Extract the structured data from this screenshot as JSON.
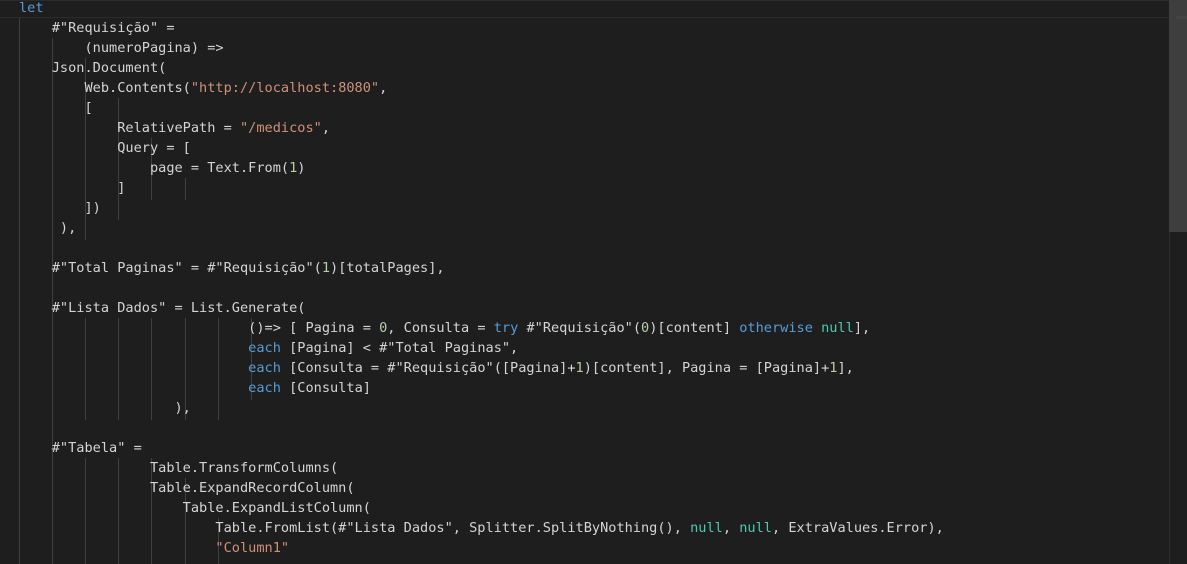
{
  "editor": {
    "language": "Power Query M",
    "colors": {
      "background": "#1e1e1e",
      "text": "#d4d4d4",
      "keyword": "#569cd6",
      "string": "#ce9178",
      "number": "#b5cea8",
      "null_literal": "#4ec9b0",
      "indent_guide": "#404040"
    },
    "lines": [
      [
        {
          "t": "let",
          "c": "kw"
        }
      ],
      [
        {
          "t": "    #\"Requisição\" ="
        }
      ],
      [
        {
          "t": "        (numeroPagina) =>"
        }
      ],
      [
        {
          "t": "    Json.Document("
        }
      ],
      [
        {
          "t": "        Web.Contents("
        },
        {
          "t": "\"http://localhost:8080\"",
          "c": "str"
        },
        {
          "t": ","
        }
      ],
      [
        {
          "t": "        ["
        }
      ],
      [
        {
          "t": "            RelativePath = "
        },
        {
          "t": "\"/medicos\"",
          "c": "str"
        },
        {
          "t": ","
        }
      ],
      [
        {
          "t": "            Query = ["
        }
      ],
      [
        {
          "t": "                page = Text.From("
        },
        {
          "t": "1",
          "c": "num"
        },
        {
          "t": ")"
        }
      ],
      [
        {
          "t": "            ]"
        }
      ],
      [
        {
          "t": "        ])"
        }
      ],
      [
        {
          "t": "     ),"
        }
      ],
      [],
      [
        {
          "t": "    #\"Total Paginas\" = #\"Requisição\"("
        },
        {
          "t": "1",
          "c": "num"
        },
        {
          "t": ")[totalPages],"
        }
      ],
      [],
      [
        {
          "t": "    #\"Lista Dados\" = List.Generate("
        }
      ],
      [
        {
          "t": "                            ()=> [ Pagina = "
        },
        {
          "t": "0",
          "c": "num"
        },
        {
          "t": ", Consulta = "
        },
        {
          "t": "try",
          "c": "kw"
        },
        {
          "t": " #\"Requisição\"("
        },
        {
          "t": "0",
          "c": "num"
        },
        {
          "t": ")[content] "
        },
        {
          "t": "otherwise",
          "c": "kw"
        },
        {
          "t": " "
        },
        {
          "t": "null",
          "c": "null"
        },
        {
          "t": "],"
        }
      ],
      [
        {
          "t": "                            "
        },
        {
          "t": "each",
          "c": "kw"
        },
        {
          "t": " [Pagina] < #\"Total Paginas\","
        }
      ],
      [
        {
          "t": "                            "
        },
        {
          "t": "each",
          "c": "kw"
        },
        {
          "t": " [Consulta = #\"Requisição\"([Pagina]+"
        },
        {
          "t": "1",
          "c": "num"
        },
        {
          "t": ")[content], Pagina = [Pagina]+"
        },
        {
          "t": "1",
          "c": "num"
        },
        {
          "t": "],"
        }
      ],
      [
        {
          "t": "                            "
        },
        {
          "t": "each",
          "c": "kw"
        },
        {
          "t": " [Consulta]"
        }
      ],
      [
        {
          "t": "                   ),"
        }
      ],
      [],
      [
        {
          "t": "    #\"Tabela\" ="
        }
      ],
      [
        {
          "t": "                Table.TransformColumns("
        }
      ],
      [
        {
          "t": "                Table.ExpandRecordColumn("
        }
      ],
      [
        {
          "t": "                    Table.ExpandListColumn("
        }
      ],
      [
        {
          "t": "                        Table.FromList(#\"Lista Dados\", Splitter.SplitByNothing(), "
        },
        {
          "t": "null",
          "c": "null"
        },
        {
          "t": ", "
        },
        {
          "t": "null",
          "c": "null"
        },
        {
          "t": ", ExtraValues.Error),"
        }
      ],
      [
        {
          "t": "                        "
        },
        {
          "t": "\"Column1\"",
          "c": "str"
        }
      ]
    ]
  }
}
